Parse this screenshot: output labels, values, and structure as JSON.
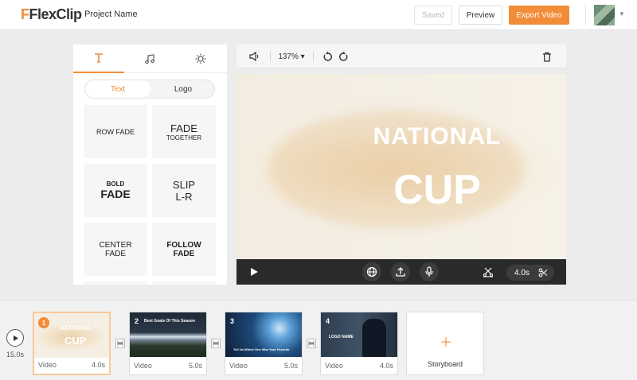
{
  "header": {
    "logo": "FlexClip",
    "project_name": "Project Name",
    "saved_label": "Saved",
    "preview_label": "Preview",
    "export_label": "Export Video"
  },
  "left_panel": {
    "tabs": [
      {
        "icon": "text-t-icon",
        "active": true
      },
      {
        "icon": "music-note-icon",
        "active": false
      },
      {
        "icon": "sun-settings-icon",
        "active": false
      }
    ],
    "segments": [
      "Text",
      "Logo"
    ],
    "tiles": [
      {
        "l1": "ROW FADE",
        "l2": ""
      },
      {
        "l1": "FADE",
        "l2": "TOGETHER"
      },
      {
        "l1": "BOLD",
        "l2": "FADE"
      },
      {
        "l1": "SLIP",
        "l2": "L-R"
      },
      {
        "l1": "CENTER",
        "l2": "FADE"
      },
      {
        "l1": "FOLLOW",
        "l2": "FADE"
      }
    ]
  },
  "toolbar": {
    "zoom": "137% ▾",
    "icons": [
      "speaker-icon",
      "undo-icon",
      "redo-icon",
      "trash-icon"
    ]
  },
  "preview": {
    "line1": "NATIONAL",
    "line2": "CUP"
  },
  "controls": {
    "duration": "4.0s",
    "icons": [
      "play-icon",
      "globe-icon",
      "upload-icon",
      "microphone-icon",
      "split-icon",
      "scissors-icon"
    ]
  },
  "timeline": {
    "total": "15.0s",
    "clips": [
      {
        "num": "1",
        "type": "Video",
        "duration": "4.0s",
        "thumb_line1": "NATIONAL",
        "thumb_line2": "CUP"
      },
      {
        "num": "2",
        "type": "Video",
        "duration": "5.0s",
        "thumb_line1": "Best Goals Of This Season",
        "thumb_line2": ""
      },
      {
        "num": "3",
        "type": "Video",
        "duration": "5.0s",
        "thumb_line1": "Tell Us Which One Was Your Favorite",
        "thumb_line2": ""
      },
      {
        "num": "4",
        "type": "Video",
        "duration": "4.0s",
        "thumb_line1": "LOGO NAME",
        "thumb_line2": ""
      }
    ],
    "storyboard_label": "Storyboard"
  },
  "colors": {
    "accent": "#f28c38",
    "dark_bar": "#2a2a2a"
  }
}
